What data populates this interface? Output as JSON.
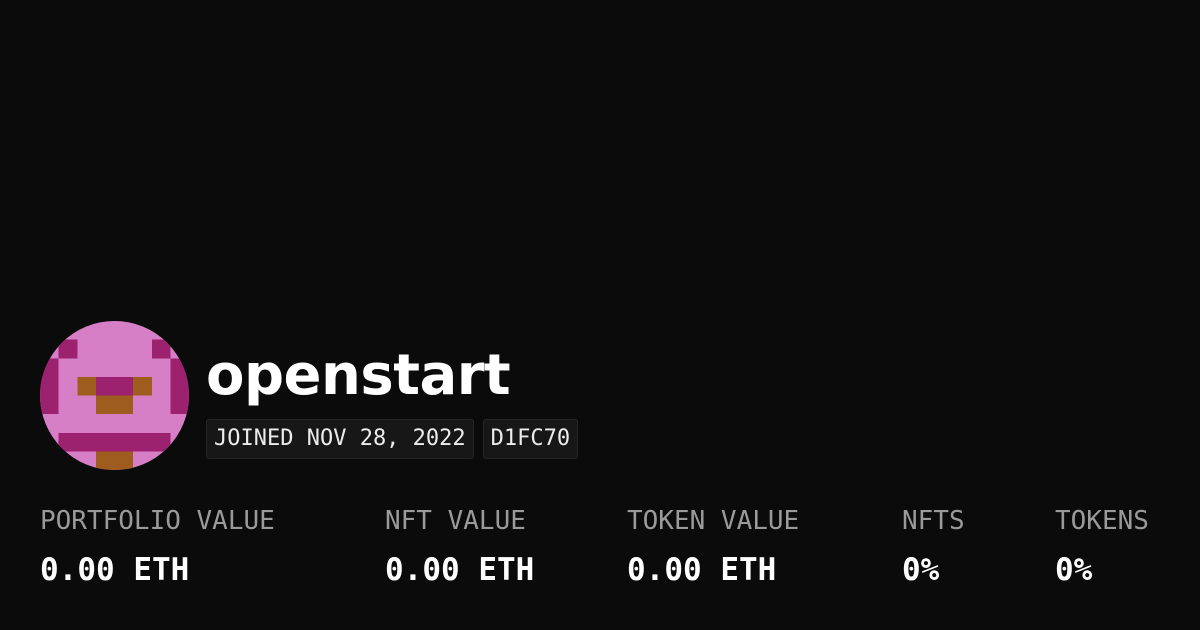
{
  "profile": {
    "username": "openstart",
    "joined": "JOINED NOV 28, 2022",
    "color_code": "D1FC70",
    "avatar": {
      "icon": "pixel-avatar-icon",
      "colors": {
        "background": "#d67fc6",
        "dark": "#9c216e",
        "accent": "#9e5d1e"
      }
    }
  },
  "stats": [
    {
      "label": "PORTFOLIO VALUE",
      "value": "0.00 ETH"
    },
    {
      "label": "NFT VALUE",
      "value": "0.00 ETH"
    },
    {
      "label": "TOKEN VALUE",
      "value": "0.00 ETH"
    },
    {
      "label": "NFTS",
      "value": "0%"
    },
    {
      "label": "TOKENS",
      "value": "0%"
    }
  ],
  "theme": {
    "background": "#0b0b0b",
    "text": "#ffffff",
    "muted_text": "#9a9a9a",
    "badge_background": "#171717"
  }
}
